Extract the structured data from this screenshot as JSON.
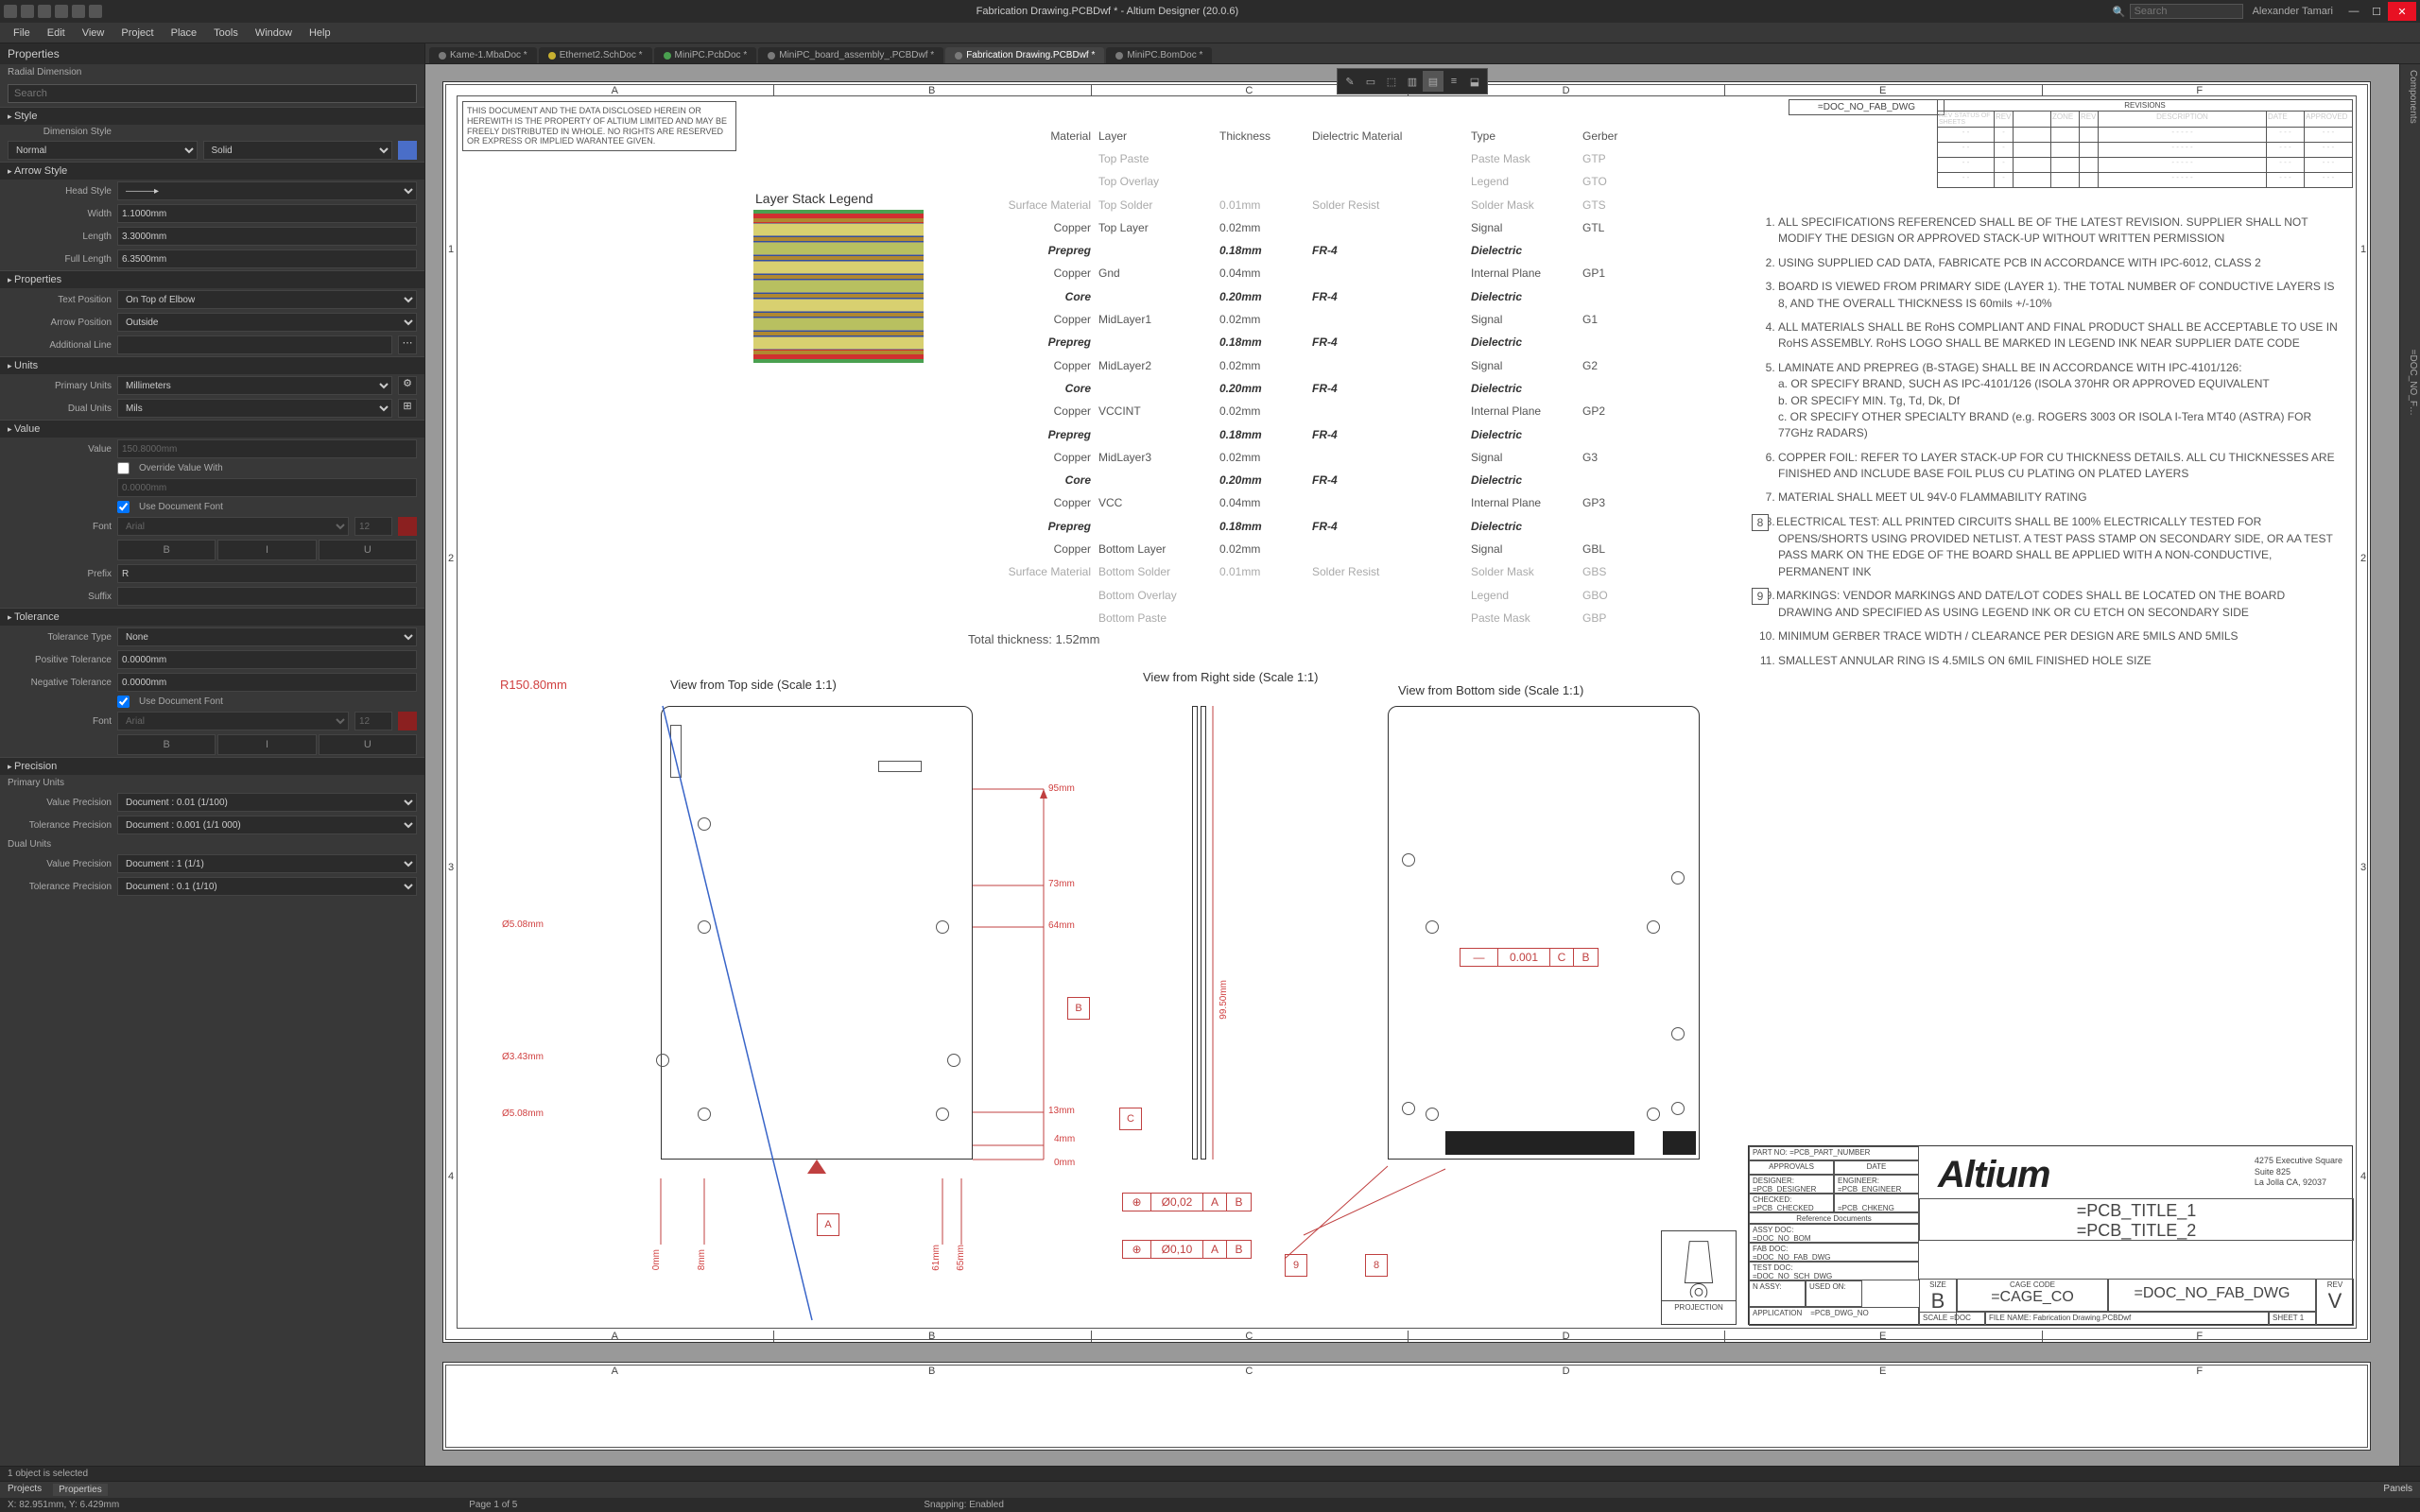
{
  "app": {
    "title_full": "Fabrication Drawing.PCBDwf * - Altium Designer (20.0.6)",
    "search_placeholder": "Search",
    "user": "Alexander Tamari",
    "menus": [
      "File",
      "Edit",
      "View",
      "Project",
      "Place",
      "Tools",
      "Window",
      "Help"
    ]
  },
  "doc_tabs": [
    {
      "label": "Kame-1.MbaDoc *",
      "color": "#7a7a7a"
    },
    {
      "label": "Ethernet2.SchDoc *",
      "color": "#c8b030"
    },
    {
      "label": "MiniPC.PcbDoc *",
      "color": "#4aa050"
    },
    {
      "label": "MiniPC_board_assembly_.PCBDwf *",
      "color": "#7a7a7a"
    },
    {
      "label": "Fabrication Drawing.PCBDwf *",
      "color": "#7a7a7a",
      "active": true
    },
    {
      "label": "MiniPC.BomDoc *",
      "color": "#7a7a7a"
    }
  ],
  "prop_panel": {
    "title": "Properties",
    "subtitle": "Radial Dimension",
    "search_placeholder": "Search",
    "sections": {
      "style": "Style",
      "arrow": "Arrow Style",
      "properties": "Properties",
      "units": "Units",
      "value": "Value",
      "tolerance": "Tolerance",
      "precision": "Precision"
    },
    "style": {
      "dimension_style_label": "Dimension Style",
      "normal": "Normal",
      "solid": "Solid"
    },
    "arrow": {
      "head_style_label": "Head Style",
      "width_label": "Width",
      "width": "1.1000mm",
      "length_label": "Length",
      "length": "3.3000mm",
      "full_length_label": "Full Length",
      "full_length": "6.3500mm"
    },
    "properties": {
      "text_pos_label": "Text Position",
      "text_pos": "On Top of Elbow",
      "arrow_pos_label": "Arrow Position",
      "arrow_pos": "Outside",
      "add_line_label": "Additional Line",
      "add_line": ""
    },
    "units": {
      "primary_label": "Primary Units",
      "primary": "Millimeters",
      "dual_label": "Dual Units",
      "dual": "Mils"
    },
    "value": {
      "value_label": "Value",
      "value": "150.8000mm",
      "override_label": "Override Value With",
      "override_val": "0.0000mm",
      "use_doc_font_label": "Use Document Font",
      "font_label": "Font",
      "font_name": "Arial",
      "font_size": "12",
      "b": "B",
      "i": "I",
      "u": "U",
      "prefix_label": "Prefix",
      "prefix": "R",
      "suffix_label": "Suffix",
      "suffix": ""
    },
    "tolerance": {
      "type_label": "Tolerance Type",
      "type_val": "None",
      "pos_label": "Positive Tolerance",
      "pos": "0.0000mm",
      "neg_label": "Negative Tolerance",
      "neg": "0.0000mm",
      "use_doc_font_label": "Use Document Font",
      "font_label": "Font",
      "font_name": "Arial",
      "font_size": "12"
    },
    "precision": {
      "primary_hdr": "Primary Units",
      "vp_label": "Value Precision",
      "vp": "Document : 0.01 (1/100)",
      "tp_label": "Tolerance Precision",
      "tp": "Document : 0.001 (1/1 000)",
      "dual_hdr": "Dual Units",
      "vp2": "Document : 1 (1/1)",
      "tp2": "Document : 0.1 (1/10)"
    }
  },
  "drawing": {
    "disclaimer": "THIS DOCUMENT AND THE DATA DISCLOSED HEREIN OR HEREWITH IS THE PROPERTY OF ALTIUM LIMITED AND MAY BE FREELY DISTRIBUTED IN WHOLE. NO RIGHTS ARE RESERVED OR EXPRESS OR IMPLIED WARANTEE GIVEN.",
    "columns": [
      "A",
      "B",
      "C",
      "D",
      "E",
      "F"
    ],
    "rows": [
      "1",
      "2",
      "3",
      "4"
    ],
    "doc_no": "=DOC_NO_FAB_DWG",
    "revisions_hdr": "REVISIONS",
    "rev_cols": [
      "REV STATUS OF SHEETS",
      "REV",
      "ZONE",
      "REV",
      "DESCRIPTION",
      "DATE",
      "APPROVED"
    ],
    "layerstack": {
      "title": "Layer Stack Legend",
      "hdr": [
        "Material",
        "Layer",
        "Thickness",
        "Dielectric Material",
        "Type",
        "Gerber"
      ],
      "rows": [
        [
          "",
          "Top Paste",
          "",
          "",
          "Paste Mask",
          "GTP"
        ],
        [
          "",
          "Top Overlay",
          "",
          "",
          "Legend",
          "GTO"
        ],
        [
          "Surface Material",
          "Top Solder",
          "0.01mm",
          "Solder Resist",
          "Solder Mask",
          "GTS"
        ],
        [
          "Copper",
          "Top Layer",
          "0.02mm",
          "",
          "Signal",
          "GTL"
        ],
        [
          "Prepreg",
          "",
          "0.18mm",
          "FR-4",
          "Dielectric",
          ""
        ],
        [
          "Copper",
          "Gnd",
          "0.04mm",
          "",
          "Internal Plane",
          "GP1"
        ],
        [
          "Core",
          "",
          "0.20mm",
          "FR-4",
          "Dielectric",
          ""
        ],
        [
          "Copper",
          "MidLayer1",
          "0.02mm",
          "",
          "Signal",
          "G1"
        ],
        [
          "Prepreg",
          "",
          "0.18mm",
          "FR-4",
          "Dielectric",
          ""
        ],
        [
          "Copper",
          "MidLayer2",
          "0.02mm",
          "",
          "Signal",
          "G2"
        ],
        [
          "Core",
          "",
          "0.20mm",
          "FR-4",
          "Dielectric",
          ""
        ],
        [
          "Copper",
          "VCCINT",
          "0.02mm",
          "",
          "Internal Plane",
          "GP2"
        ],
        [
          "Prepreg",
          "",
          "0.18mm",
          "FR-4",
          "Dielectric",
          ""
        ],
        [
          "Copper",
          "MidLayer3",
          "0.02mm",
          "",
          "Signal",
          "G3"
        ],
        [
          "Core",
          "",
          "0.20mm",
          "FR-4",
          "Dielectric",
          ""
        ],
        [
          "Copper",
          "VCC",
          "0.04mm",
          "",
          "Internal Plane",
          "GP3"
        ],
        [
          "Prepreg",
          "",
          "0.18mm",
          "FR-4",
          "Dielectric",
          ""
        ],
        [
          "Copper",
          "Bottom Layer",
          "0.02mm",
          "",
          "Signal",
          "GBL"
        ],
        [
          "Surface Material",
          "Bottom Solder",
          "0.01mm",
          "Solder Resist",
          "Solder Mask",
          "GBS"
        ],
        [
          "",
          "Bottom Overlay",
          "",
          "",
          "Legend",
          "GBO"
        ],
        [
          "",
          "Bottom Paste",
          "",
          "",
          "Paste Mask",
          "GBP"
        ]
      ],
      "total": "Total thickness: 1.52mm"
    },
    "views": {
      "top": "View from Top side (Scale 1:1)",
      "right": "View from Right side (Scale 1:1)",
      "bottom": "View from Bottom side (Scale 1:1)"
    },
    "dims": {
      "R": "R150.80mm",
      "d1": "Ø5.08mm",
      "d2": "Ø3.43mm",
      "d3": "Ø5.08mm",
      "h95": "95mm",
      "h73": "73mm",
      "h64": "64mm",
      "h13": "13mm",
      "h4": "4mm",
      "h0": "0mm",
      "w0": "0mm",
      "w8": "8mm",
      "w61": "61mm",
      "w65": "65mm",
      "rh": "99.50mm",
      "gd1": "Ø0,02",
      "gd2": "Ø0,10",
      "g001": "0.001"
    },
    "datums": [
      "A",
      "B",
      "C"
    ],
    "specs": [
      "ALL SPECIFICATIONS REFERENCED SHALL BE OF THE LATEST REVISION. SUPPLIER SHALL NOT MODIFY THE DESIGN OR APPROVED STACK-UP WITHOUT WRITTEN PERMISSION",
      "USING SUPPLIED CAD DATA, FABRICATE PCB IN ACCORDANCE WITH IPC-6012, CLASS 2",
      "BOARD IS VIEWED FROM PRIMARY SIDE (LAYER 1). THE TOTAL NUMBER OF CONDUCTIVE LAYERS IS 8, AND THE OVERALL THICKNESS IS 60mils +/-10%",
      "ALL MATERIALS SHALL BE RoHS COMPLIANT AND FINAL PRODUCT SHALL BE ACCEPTABLE TO USE IN RoHS ASSEMBLY. RoHS LOGO SHALL BE MARKED IN LEGEND INK NEAR SUPPLIER DATE CODE",
      "LAMINATE AND PREPREG (B-STAGE) SHALL BE IN ACCORDANCE WITH IPC-4101/126:\na. OR SPECIFY BRAND, SUCH AS IPC-4101/126 (ISOLA 370HR OR APPROVED EQUIVALENT\nb. OR SPECIFY MIN. Tg, Td, Dk, Df\nc. OR SPECIFY OTHER SPECIALTY BRAND (e.g. ROGERS 3003 OR ISOLA I-Tera MT40 (ASTRA) FOR 77GHz RADARS)",
      "COPPER FOIL: REFER TO LAYER STACK-UP FOR CU THICKNESS DETAILS. ALL CU THICKNESSES ARE FINISHED AND INCLUDE BASE FOIL PLUS CU PLATING ON PLATED LAYERS",
      "MATERIAL SHALL MEET UL 94V-0 FLAMMABILITY RATING",
      "ELECTRICAL TEST: ALL PRINTED CIRCUITS SHALL BE 100% ELECTRICALLY TESTED FOR OPENS/SHORTS USING PROVIDED NETLIST. A TEST PASS STAMP ON SECONDARY SIDE, OR AA TEST PASS MARK ON THE EDGE OF THE BOARD SHALL BE APPLIED WITH A NON-CONDUCTIVE, PERMANENT INK",
      "MARKINGS: VENDOR MARKINGS AND DATE/LOT CODES SHALL BE LOCATED ON THE BOARD DRAWING AND SPECIFIED AS USING LEGEND INK OR CU ETCH ON SECONDARY SIDE",
      "MINIMUM GERBER TRACE WIDTH / CLEARANCE PER DESIGN ARE 5MILS AND 5MILS",
      "SMALLEST ANNULAR RING IS 4.5MILS ON 6MIL FINISHED HOLE SIZE"
    ],
    "titleblock": {
      "logo": "Altium",
      "addr1": "4275 Executive Square",
      "addr2": "Suite 825",
      "addr3": "La Jolla CA, 92037",
      "t1": "=PCB_TITLE_1",
      "t2": "=PCB_TITLE_2",
      "partno_lbl": "PART NO:",
      "partno": "=PCB_PART_NUMBER",
      "approvals": "APPROVALS",
      "date": "DATE",
      "designer_lbl": "DESIGNER:",
      "designer": "=PCB_DESIGNER",
      "engineer_lbl": "ENGINEER:",
      "engineer": "=PCB_ENGINEER",
      "checked_lbl": "CHECKED:",
      "checked": "=PCB_CHECKED",
      "chkeng": "=PCB_CHKENG",
      "refdoc_lbl": "Reference Documents",
      "assy_lbl": "ASSY DOC:",
      "assy": "=DOC_NO_BOM",
      "fab_lbl": "FAB DOC:",
      "fab": "=DOC_NO_FAB_DWG",
      "test_lbl": "TEST DOC:",
      "test": "=DOC_NO_SCH_DWG",
      "nassy_lbl": "N ASSY:",
      "usedon_lbl": "USED ON:",
      "dwgno": "=PCB_DWG_NO",
      "size_lbl": "SIZE",
      "size": "B",
      "cage_lbl": "CAGE CODE",
      "cage": "=CAGE_CO",
      "scale_lbl": "SCALE",
      "scale": "=DOC",
      "docno": "=DOC_NO_FAB_DWG",
      "rev_lbl": "REV",
      "rev": "V",
      "filename_lbl": "FILE NAME:",
      "filename": "Fabrication Drawing.PCBDwf",
      "sheet_lbl": "SHEET",
      "sheet": "1"
    },
    "proj_lbl": "PROJECTION"
  },
  "status": {
    "selection": "1 object is selected",
    "tabs": {
      "projects": "Projects",
      "properties": "Properties",
      "panels": "Panels"
    },
    "coord": "X: 82.951mm, Y: 6.429mm",
    "page": "Page 1 of 5",
    "snap": "Snapping: Enabled"
  }
}
